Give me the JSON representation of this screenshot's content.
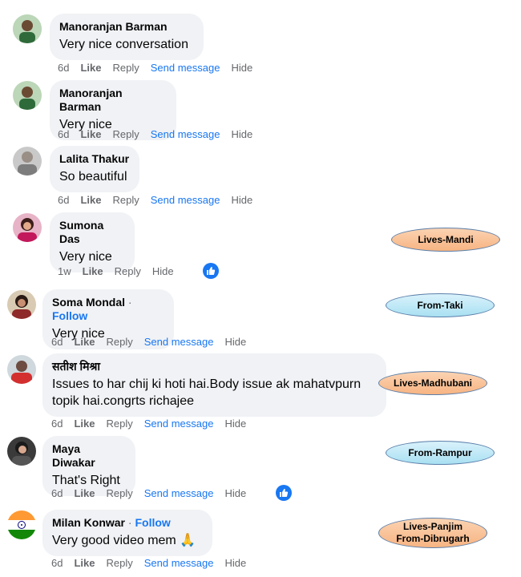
{
  "comments": [
    {
      "name": "Manoranjan Barman",
      "follow": "",
      "text": "Very nice conversation",
      "time": "6d",
      "like": "Like",
      "reply": "Reply",
      "send": "Send message",
      "hide": "Hide"
    },
    {
      "name": "Manoranjan Barman",
      "follow": "",
      "text": "Very nice",
      "time": "6d",
      "like": "Like",
      "reply": "Reply",
      "send": "Send message",
      "hide": "Hide"
    },
    {
      "name": "Lalita Thakur",
      "follow": "",
      "text": "So beautiful",
      "time": "6d",
      "like": "Like",
      "reply": "Reply",
      "send": "Send message",
      "hide": "Hide"
    },
    {
      "name": "Sumona Das",
      "follow": "",
      "text": "Very nice",
      "time": "1w",
      "like": "Like",
      "reply": "Reply",
      "send": "",
      "hide": "Hide"
    },
    {
      "name": "Soma Mondal",
      "follow": "Follow",
      "text": "Very nice",
      "time": "6d",
      "like": "Like",
      "reply": "Reply",
      "send": "Send message",
      "hide": "Hide"
    },
    {
      "name": "सतीश मिश्रा",
      "follow": "",
      "text": "Issues to har chij ki hoti hai.Body issue ak mahatvpurn topik hai.congrts richajee",
      "time": "6d",
      "like": "Like",
      "reply": "Reply",
      "send": "Send message",
      "hide": "Hide"
    },
    {
      "name": "Maya Diwakar",
      "follow": "",
      "text": "That's Right",
      "time": "6d",
      "like": "Like",
      "reply": "Reply",
      "send": "Send message",
      "hide": "Hide"
    },
    {
      "name": "Milan Konwar",
      "follow": "Follow",
      "text": "Very good video mem 🙏",
      "time": "6d",
      "like": "Like",
      "reply": "Reply",
      "send": "Send message",
      "hide": "Hide"
    }
  ],
  "tags": [
    {
      "text": "Lives-Mandi",
      "style": "orange"
    },
    {
      "text": "From-Taki",
      "style": "blue"
    },
    {
      "text": "Lives-Madhubani",
      "style": "orange"
    },
    {
      "text": "From-Rampur",
      "style": "blue"
    },
    {
      "text": "Lives-Panjim\nFrom-Dibrugarh",
      "style": "orange"
    }
  ],
  "colors": {
    "accent": "#1877f2",
    "bubble": "#f0f2f5",
    "meta": "#65676b"
  },
  "icons": {
    "reaction": "thumbs-up-icon"
  }
}
